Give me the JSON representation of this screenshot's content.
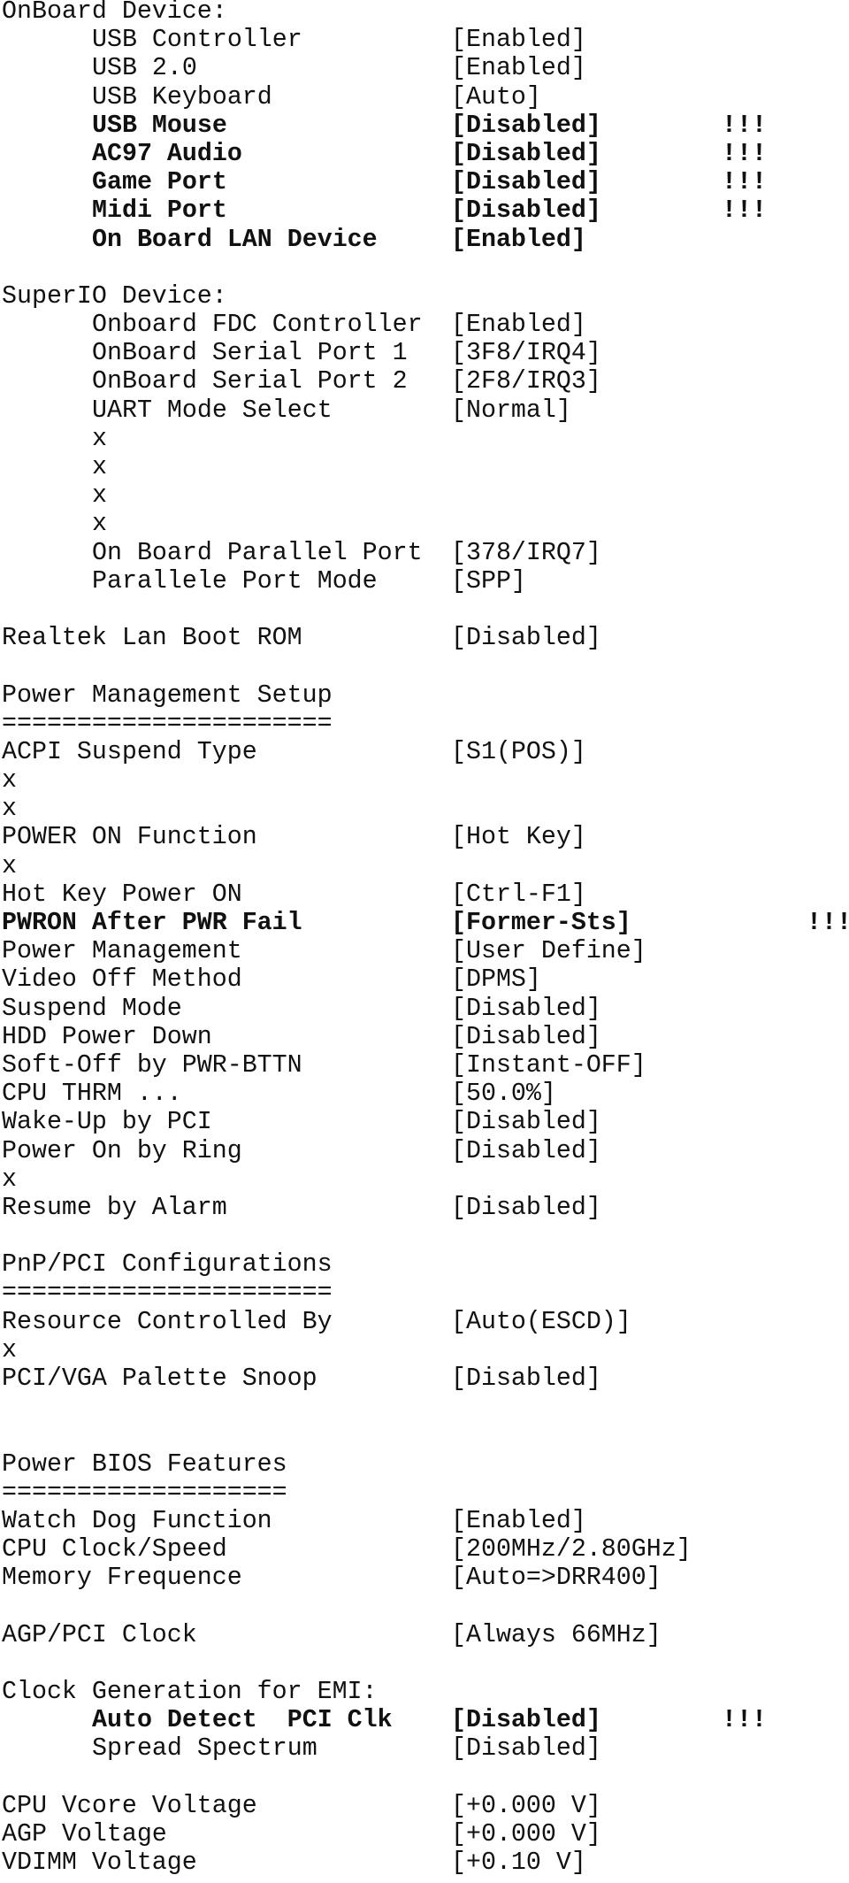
{
  "onboard_device": {
    "title": "OnBoard Device:",
    "items": [
      {
        "label": "USB Controller",
        "value": "[Enabled]"
      },
      {
        "label": "USB 2.0",
        "value": "[Enabled]"
      },
      {
        "label": "USB Keyboard",
        "value": "[Auto]"
      },
      {
        "label": "USB Mouse",
        "value": "[Disabled]",
        "flag": "!!!"
      },
      {
        "label": "AC97 Audio",
        "value": "[Disabled]",
        "flag": "!!!"
      },
      {
        "label": "Game Port",
        "value": "[Disabled]",
        "flag": "!!!"
      },
      {
        "label": "Midi Port",
        "value": "[Disabled]",
        "flag": "!!!"
      },
      {
        "label": "On Board LAN Device",
        "value": "[Enabled]"
      }
    ]
  },
  "superio_device": {
    "title": "SuperIO Device:",
    "items": [
      {
        "label": "Onboard FDC Controller",
        "value": "[Enabled]"
      },
      {
        "label": "OnBoard Serial Port 1",
        "value": "[3F8/IRQ4]"
      },
      {
        "label": "OnBoard Serial Port 2",
        "value": "[2F8/IRQ3]"
      },
      {
        "label": "UART Mode Select",
        "value": "[Normal]"
      },
      {
        "label": "x"
      },
      {
        "label": "x"
      },
      {
        "label": "x"
      },
      {
        "label": "x"
      },
      {
        "label": "On Board Parallel Port",
        "value": "[378/IRQ7]"
      },
      {
        "label": "Parallele Port Mode",
        "value": "[SPP]"
      }
    ]
  },
  "realtek": {
    "label": "Realtek Lan Boot ROM",
    "value": "[Disabled]"
  },
  "power_management": {
    "title": "Power Management Setup",
    "separator": "======================",
    "items": [
      {
        "label": "ACPI Suspend Type",
        "value": "[S1(POS)]"
      },
      {
        "label": "x"
      },
      {
        "label": "x"
      },
      {
        "label": "POWER ON Function",
        "value": "[Hot Key]"
      },
      {
        "label": "x"
      },
      {
        "label": "Hot Key Power ON",
        "value": "[Ctrl-F1]"
      },
      {
        "label": "PWRON After PWR Fail",
        "value": "[Former-Sts]",
        "flag": "!!!"
      },
      {
        "label": "Power Management",
        "value": "[User Define]"
      },
      {
        "label": "Video Off Method",
        "value": "[DPMS]"
      },
      {
        "label": "Suspend Mode",
        "value": "[Disabled]"
      },
      {
        "label": "HDD Power Down",
        "value": "[Disabled]"
      },
      {
        "label": "Soft-Off by PWR-BTTN",
        "value": "[Instant-OFF]"
      },
      {
        "label": "CPU THRM ...",
        "value": "[50.0%]"
      },
      {
        "label": "Wake-Up by PCI",
        "value": "[Disabled]"
      },
      {
        "label": "Power On by Ring",
        "value": "[Disabled]"
      },
      {
        "label": "x"
      },
      {
        "label": "Resume by Alarm",
        "value": "[Disabled]"
      }
    ]
  },
  "pnp_pci": {
    "title": "PnP/PCI Configurations",
    "separator": "======================",
    "items": [
      {
        "label": "Resource Controlled By",
        "value": "[Auto(ESCD)]"
      },
      {
        "label": "x"
      },
      {
        "label": "PCI/VGA Palette Snoop",
        "value": "[Disabled]"
      }
    ]
  },
  "power_bios": {
    "title": "Power BIOS Features",
    "separator": "===================",
    "items": [
      {
        "label": "Watch Dog Function",
        "value": "[Enabled]"
      },
      {
        "label": "CPU Clock/Speed",
        "value": "[200MHz/2.80GHz]"
      },
      {
        "label": "Memory Frequence",
        "value": "[Auto=>DRR400]"
      },
      {
        "label": "AGP/PCI Clock",
        "value": "[Always 66MHz]"
      }
    ]
  },
  "clock_emi": {
    "title": "Clock Generation for EMI:",
    "items": [
      {
        "label": "Auto Detect  PCI Clk",
        "value": "[Disabled]",
        "flag": "!!!"
      },
      {
        "label": "Spread Spectrum",
        "value": "[Disabled]"
      }
    ]
  },
  "voltages": {
    "items": [
      {
        "label": "CPU Vcore Voltage",
        "value": "[+0.000 V]"
      },
      {
        "label": "AGP Voltage",
        "value": "[+0.000 V]"
      },
      {
        "label": "VDIMM Voltage",
        "value": "[+0.10 V]"
      }
    ]
  }
}
